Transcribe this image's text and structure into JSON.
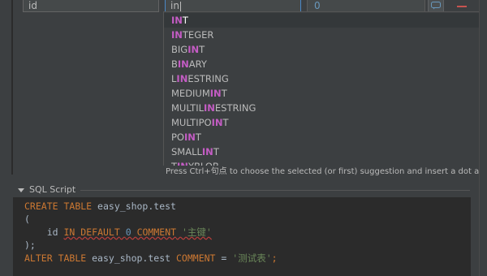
{
  "row": {
    "name": "id",
    "type_input": "in",
    "length": "0"
  },
  "completion": {
    "items": [
      {
        "pre": "",
        "hl": "IN",
        "post": "T"
      },
      {
        "pre": "",
        "hl": "IN",
        "post": "TEGER"
      },
      {
        "pre": "BIG",
        "hl": "IN",
        "post": "T"
      },
      {
        "pre": "B",
        "hl": "IN",
        "post": "ARY"
      },
      {
        "pre": "L",
        "hl": "IN",
        "post": "ESTRING"
      },
      {
        "pre": "MEDIUM",
        "hl": "IN",
        "post": "T"
      },
      {
        "pre": "MULTIL",
        "hl": "IN",
        "post": "ESTRING"
      },
      {
        "pre": "MULTIPO",
        "hl": "IN",
        "post": "T"
      },
      {
        "pre": "PO",
        "hl": "IN",
        "post": "T"
      },
      {
        "pre": "SMALL",
        "hl": "IN",
        "post": "T"
      },
      {
        "pre": "T",
        "hl": "IN",
        "post": "YBLOB"
      }
    ],
    "hint": "Press Ctrl+句点 to choose the selected (or first) suggestion and insert a dot afterwards"
  },
  "sql_section": {
    "title": "SQL Script",
    "line1": {
      "k1": "CREATE",
      "k2": "TABLE",
      "name": "easy_shop.test"
    },
    "line2": "(",
    "line3": {
      "col": "id",
      "type": "IN",
      "k_default": "DEFAULT",
      "default": "0",
      "k_comment": "COMMENT",
      "comment": "'主键'"
    },
    "line4": ");",
    "line5": {
      "k1": "ALTER",
      "k2": "TABLE",
      "name": "easy_shop.test",
      "k3": "COMMENT",
      "eq": "=",
      "comment": "'测试表'",
      "end": ";"
    }
  },
  "colors": {
    "background": "#3c3f41",
    "editor": "#2b2b2b",
    "keyword": "#cc7832",
    "string": "#6a8759",
    "number": "#6897bb",
    "match_highlight": "#c45cc4",
    "remove": "#c75450"
  }
}
